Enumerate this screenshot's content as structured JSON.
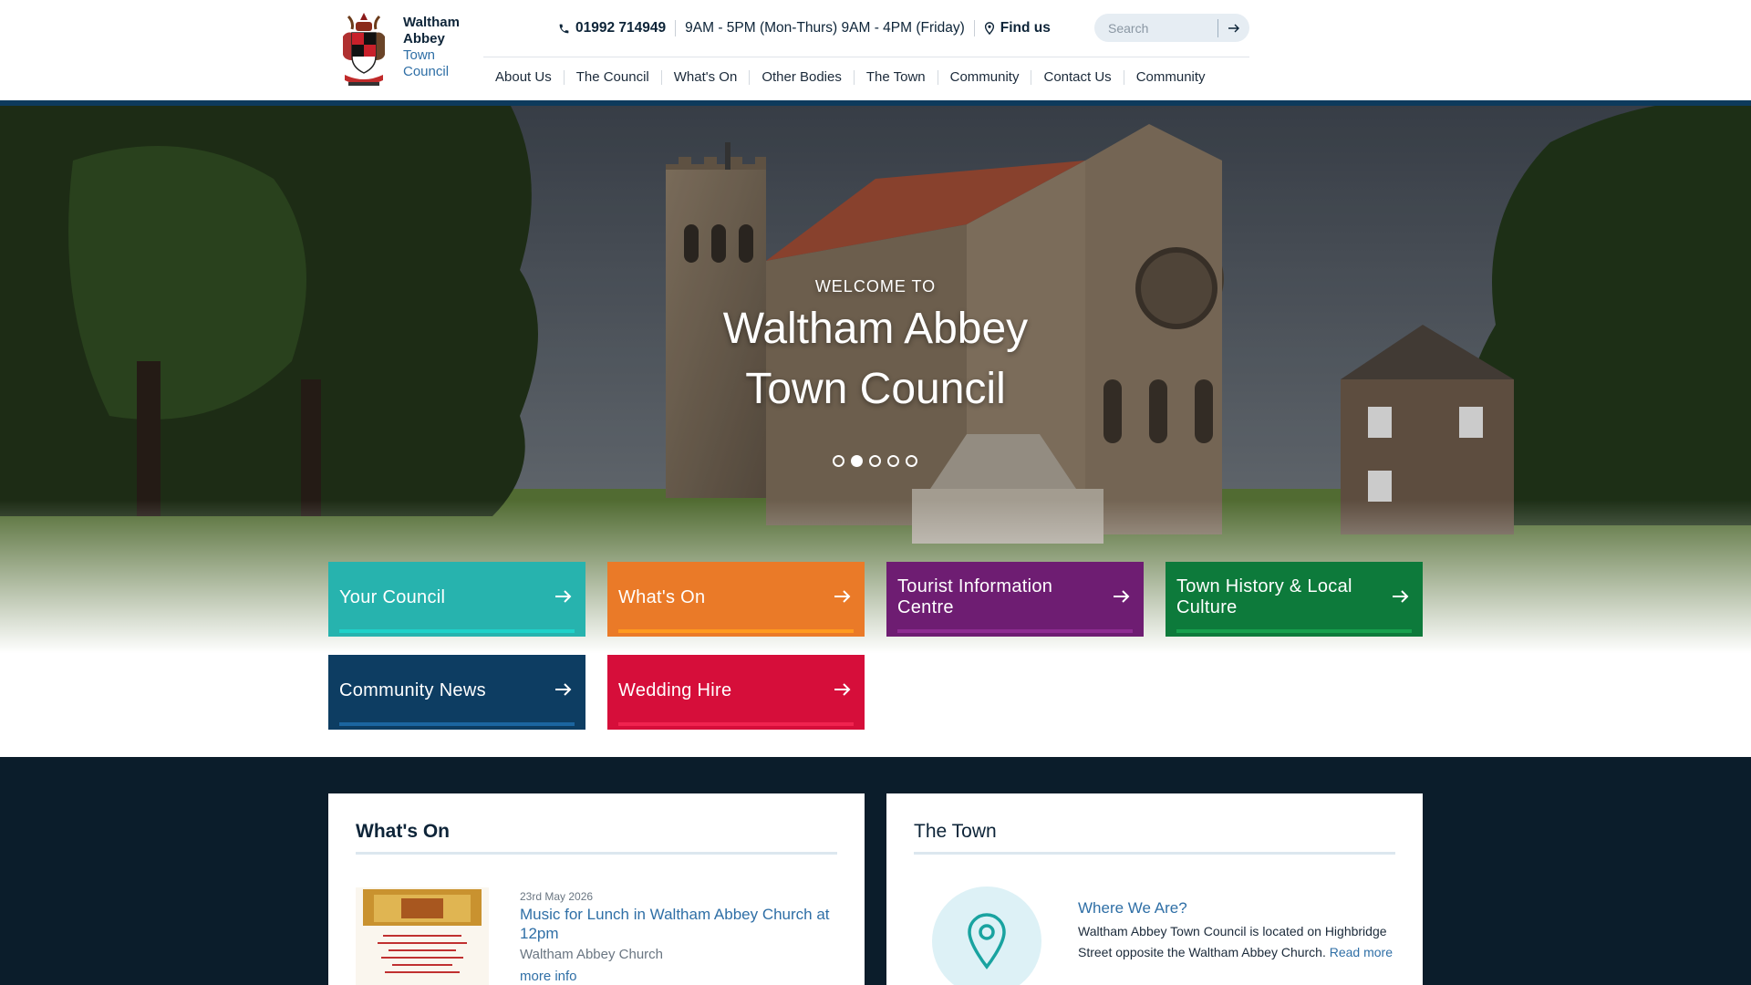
{
  "logo": {
    "line1": "Waltham",
    "line2": "Abbey",
    "line3": "Town",
    "line4": "Council"
  },
  "topbar": {
    "phone": "01992 714949",
    "hours": "9AM - 5PM (Mon-Thurs) 9AM - 4PM (Friday)",
    "find_us": "Find us",
    "search_placeholder": "Search"
  },
  "nav": [
    "About Us",
    "The Council",
    "What's On",
    "Other Bodies",
    "The Town",
    "Community",
    "Contact Us",
    "Community"
  ],
  "hero": {
    "kicker": "WELCOME TO",
    "title_line1": "Waltham Abbey",
    "title_line2": "Town Council",
    "slide_count": 5,
    "active_slide": 2
  },
  "tiles": [
    {
      "label": "Your Council",
      "color": "#27b3ae",
      "line": "#1fd2c9"
    },
    {
      "label": "What's On",
      "color": "#ea7a28",
      "line": "#ff9a1f"
    },
    {
      "label": "Tourist Information Centre",
      "color": "#6e1d72",
      "line": "#8e2c92"
    },
    {
      "label": "Town History & Local Culture",
      "color": "#0d7a3b",
      "line": "#16a04d"
    },
    {
      "label": "Community News",
      "color": "#0d3d62",
      "line": "#1b65a0"
    },
    {
      "label": "Wedding Hire",
      "color": "#d60e3a",
      "line": "#f0234f"
    }
  ],
  "whats_on": {
    "heading": "What's On",
    "event": {
      "date": "23rd May 2026",
      "title": "Music for Lunch in Waltham Abbey Church at 12pm",
      "venue": "Waltham Abbey Church",
      "more": "more info"
    }
  },
  "the_town": {
    "heading": "The Town",
    "subheading": "Where We Are?",
    "body": "Waltham Abbey Town Council is located on Highbridge Street opposite the Waltham Abbey Church.",
    "read_more": "Read more"
  }
}
